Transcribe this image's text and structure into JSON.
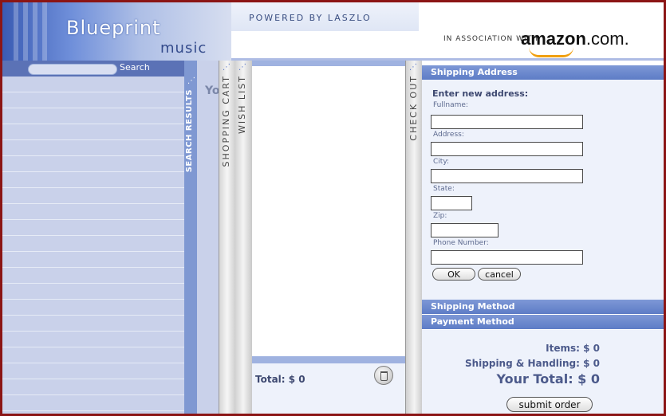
{
  "logo": {
    "title": "Blueprint",
    "subtitle": "music"
  },
  "header": {
    "powered_by": "POWERED BY LASZLO",
    "association": "IN ASSOCIATION WITH",
    "amazon_brand": "amazon",
    "amazon_suffix": ".com."
  },
  "search": {
    "placeholder": "",
    "button_label": "Search"
  },
  "tabs": {
    "search_results": "SEARCH RESULTS",
    "shopping_cart": "SHOPPING CART",
    "wish_list": "WISH LIST",
    "check_out": "CHECK OUT",
    "handle_glyph": "⋰"
  },
  "results_panel": {
    "partial_label": "Yo"
  },
  "wishlist": {
    "total_label": "Total: $ 0"
  },
  "checkout": {
    "shipping_address_header": "Shipping Address",
    "enter_new_address": "Enter new address:",
    "fields": {
      "fullname": "Fullname:",
      "address": "Address:",
      "city": "City:",
      "state": "State:",
      "zip": "Zip:",
      "phone": "Phone Number:"
    },
    "ok_label": "OK",
    "cancel_label": "cancel",
    "shipping_method_header": "Shipping Method",
    "payment_method_header": "Payment Method",
    "items_line": "Items: $  0",
    "shipping_line": "Shipping & Handling: $  0",
    "your_total_line": "Your Total: $  0",
    "submit_label": "submit order"
  },
  "colors": {
    "frame_border": "#8b1515",
    "tab_blue": "#7f98d2",
    "header_blue": "#5d7cc6",
    "panel_bg": "#eef2fb",
    "amazon_smile": "#f1a011"
  }
}
